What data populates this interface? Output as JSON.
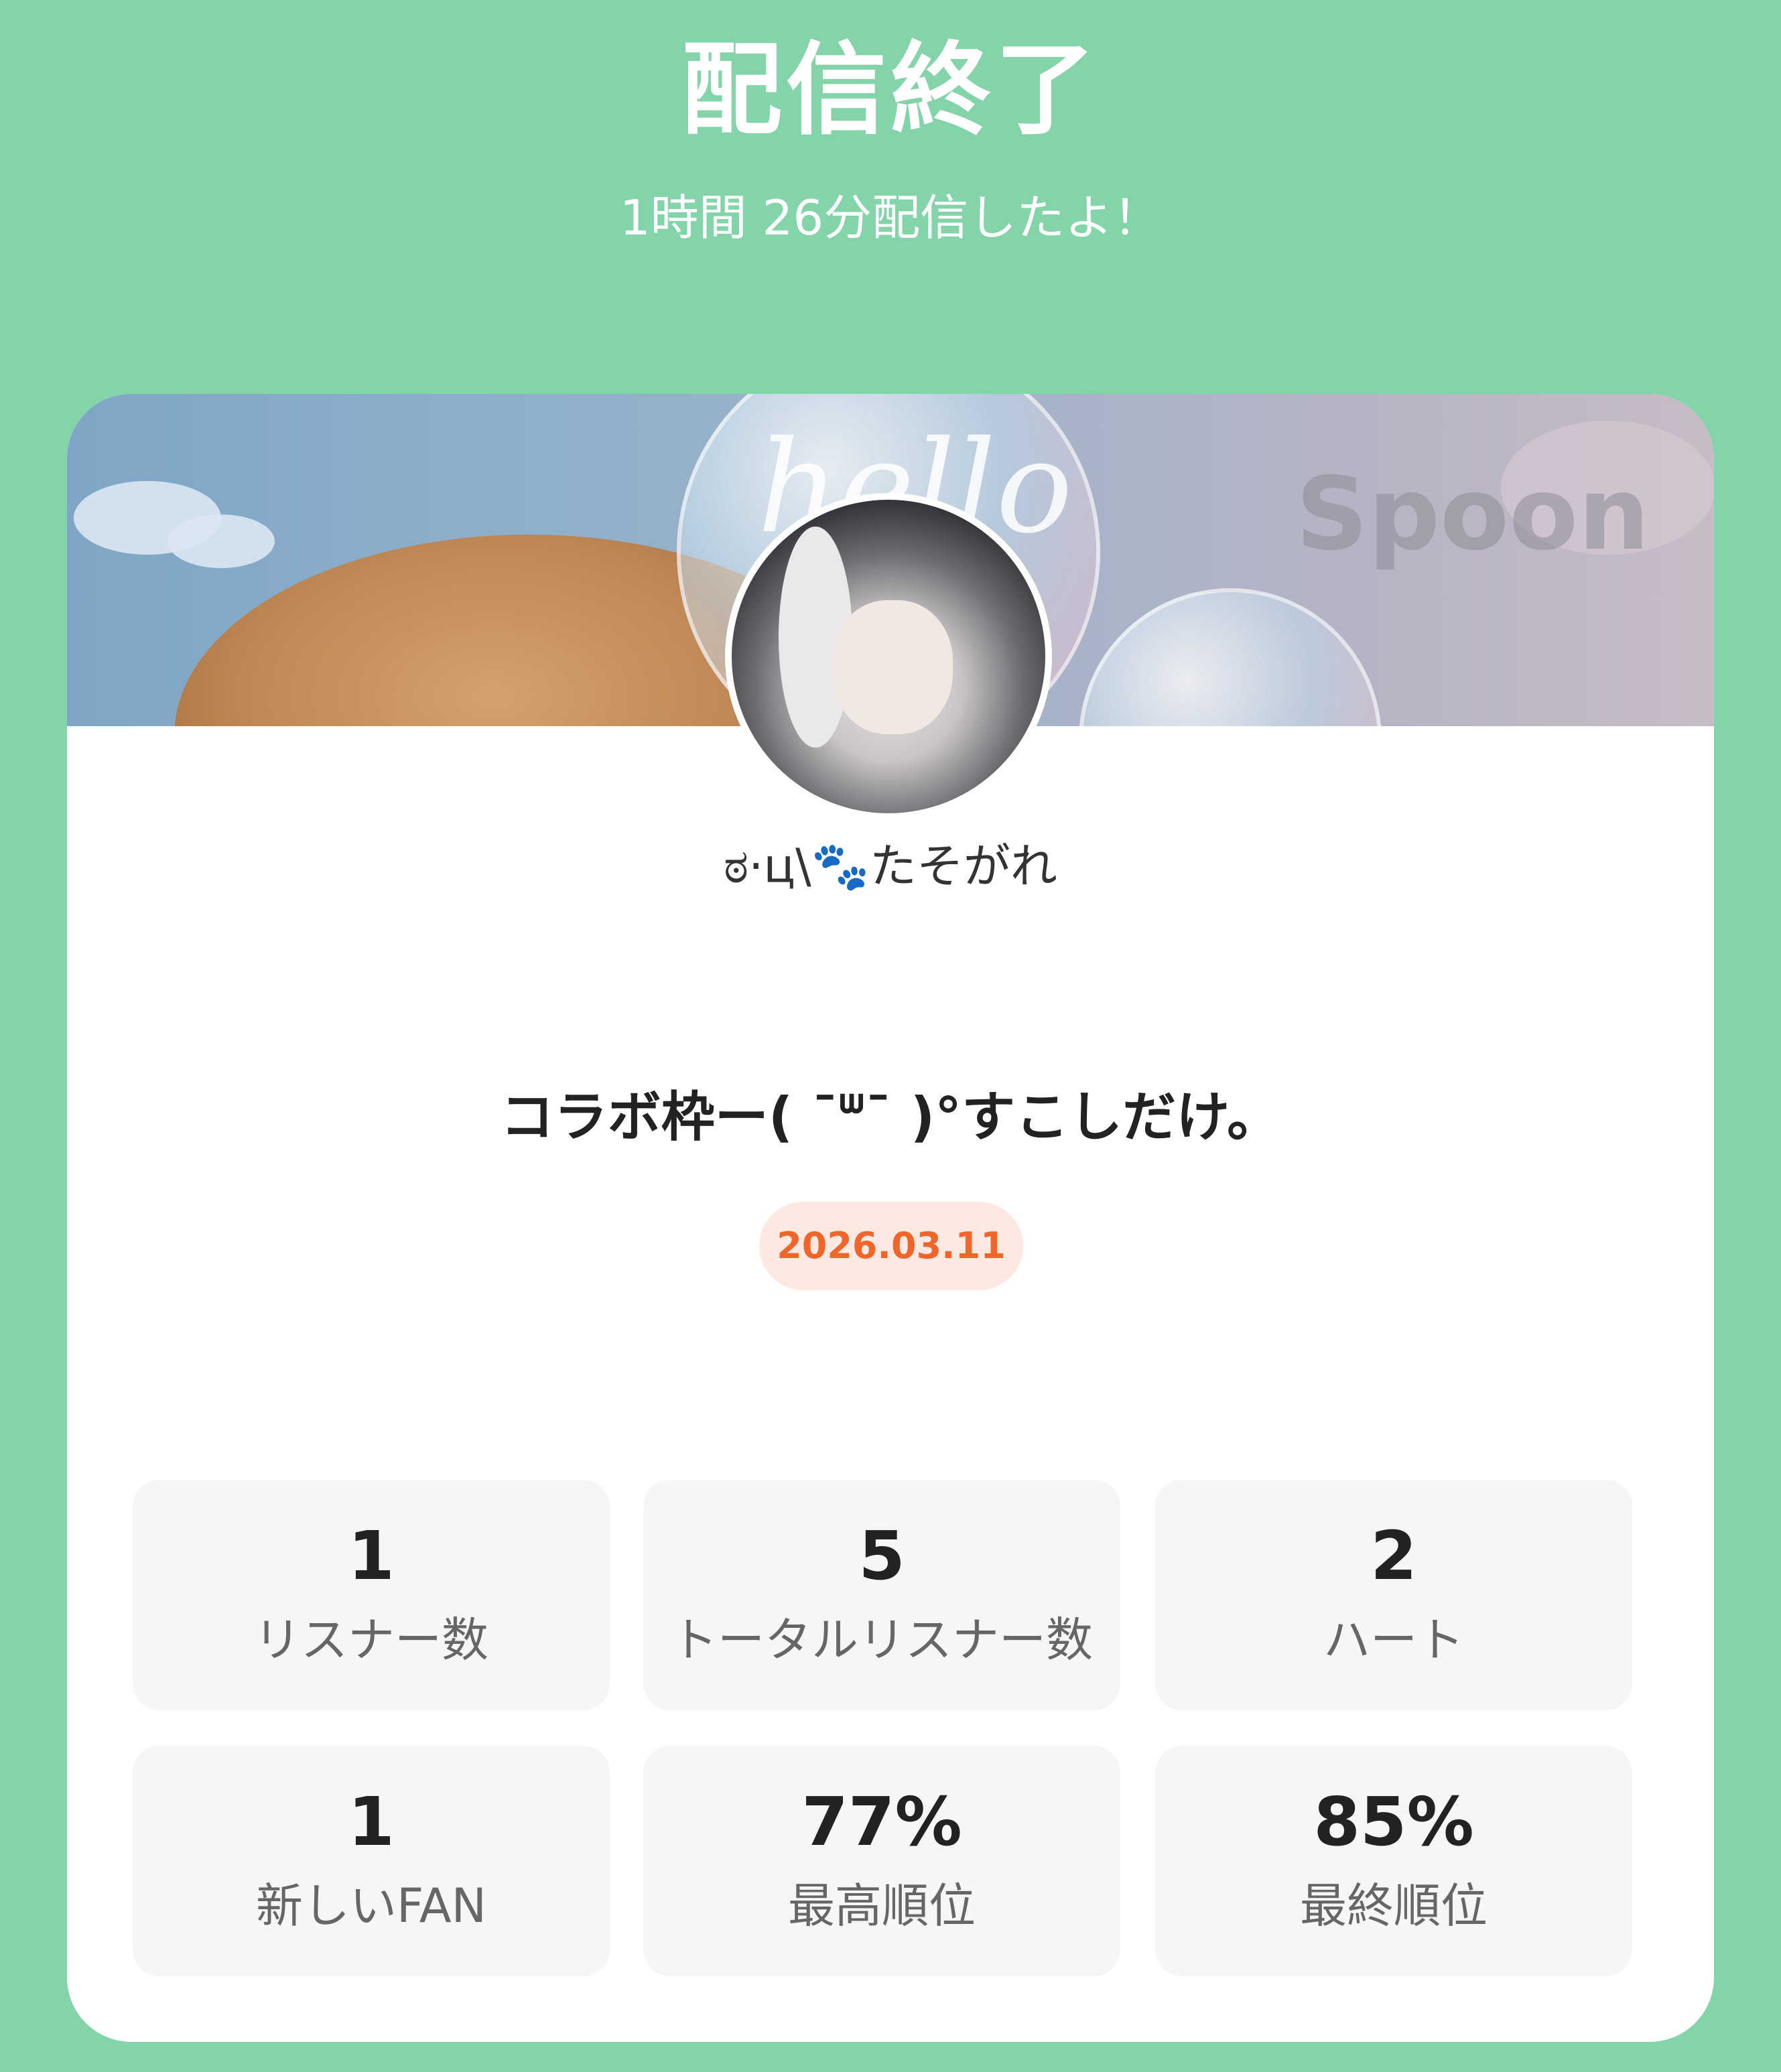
{
  "header": {
    "title": "配信終了",
    "subtitle": "1時間 26分配信したよ！"
  },
  "banner": {
    "bubble_text": "hello",
    "watermark": "Spoon"
  },
  "profile": {
    "name_prefix": "ಠ·ц\\",
    "paw_symbol": "🐾",
    "name_suffix": "たそがれ"
  },
  "live": {
    "title": "コラボ枠ー( ¯ᐜ¯ )°すこしだけ。",
    "date": "2026.03.11"
  },
  "stats": [
    {
      "value": "1",
      "label": "リスナー数"
    },
    {
      "value": "5",
      "label": "トータルリスナー数"
    },
    {
      "value": "2",
      "label": "ハート"
    },
    {
      "value": "1",
      "label": "新しいFAN"
    },
    {
      "value": "77%",
      "label": "最高順位"
    },
    {
      "value": "85%",
      "label": "最終順位"
    }
  ],
  "colors": {
    "background": "#83d4a8",
    "card": "#ffffff",
    "date_text": "#f0652a",
    "date_badge_bg": "#fde9e1",
    "stat_bg": "#f6f6f6"
  }
}
